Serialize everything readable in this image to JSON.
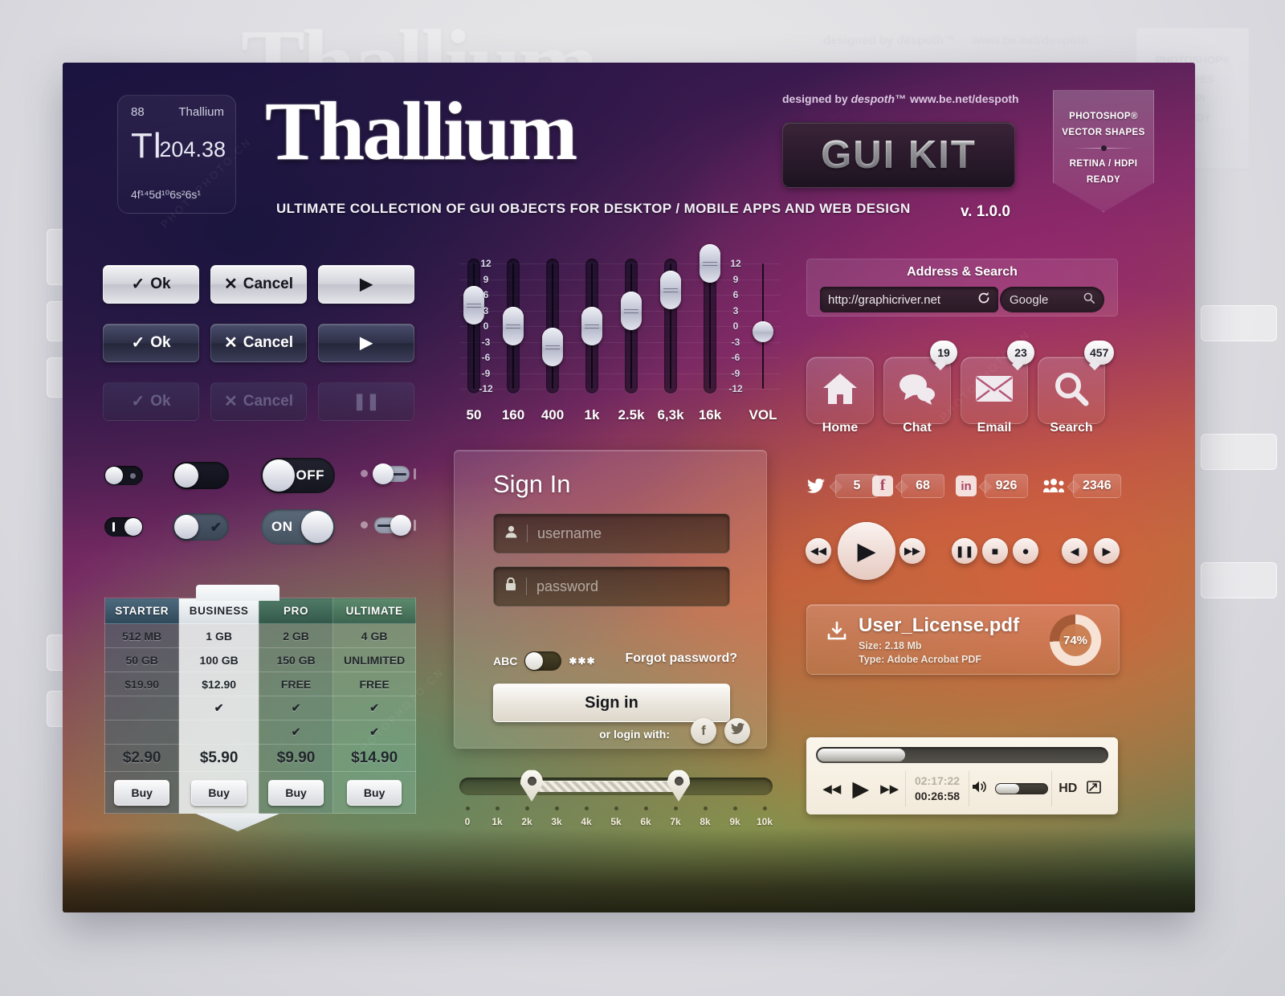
{
  "ghost": {
    "title": "Thallium",
    "credit": "designed by despoth™",
    "url": "www.be.net/despoth",
    "badge_line1": "PHOTOSHOP®",
    "badge_line2": "SHAPES",
    "badge_line3": "HDPI",
    "badge_line4": "READY"
  },
  "header": {
    "element": {
      "number": "88",
      "name": "Thallium",
      "symbol": "Tl",
      "mass": "204.38",
      "config": "4f¹⁴5d¹⁰6s²6s¹"
    },
    "brand": "Thallium",
    "tagline": "ULTIMATE COLLECTION OF GUI OBJECTS FOR DESKTOP / MOBILE APPS AND WEB DESIGN",
    "version": "v. 1.0.0",
    "credit": "designed by",
    "credit_brand": "despoth™",
    "url": "www.be.net/despoth",
    "gui_kit": "GUI KIT",
    "ps_badge": {
      "line1": "PHOTOSHOP®",
      "line2": "VECTOR SHAPES",
      "line3": "RETINA / HDPI",
      "line4": "READY"
    }
  },
  "buttons": {
    "rows": [
      {
        "style": "light",
        "ok": "Ok",
        "cancel": "Cancel",
        "play": "▶"
      },
      {
        "style": "dark",
        "ok": "Ok",
        "cancel": "Cancel",
        "play": "▶"
      },
      {
        "style": "disabled",
        "ok": "Ok",
        "cancel": "Cancel",
        "play": "❚❚"
      }
    ],
    "check_glyph": "✓",
    "x_glyph": "✕"
  },
  "equalizer": {
    "bands": [
      {
        "label": "50",
        "value": 4
      },
      {
        "label": "160",
        "value": 0
      },
      {
        "label": "400",
        "value": -4
      },
      {
        "label": "1k",
        "value": 0
      },
      {
        "label": "2.5k",
        "value": 3
      },
      {
        "label": "6,3k",
        "value": 7
      },
      {
        "label": "16k",
        "value": 12
      }
    ],
    "volume": {
      "label": "VOL",
      "value": -1
    },
    "scale": [
      "12",
      "9",
      "6",
      "3",
      "0",
      "-3",
      "-6",
      "-9",
      "-12"
    ],
    "scale_range": [
      -12,
      12
    ]
  },
  "toggles": {
    "off_label": "OFF",
    "on_label": "ON",
    "check_glyph": "✔"
  },
  "pricing": {
    "columns": [
      "STARTER",
      "BUSINESS",
      "PRO",
      "ULTIMATE"
    ],
    "rows": [
      [
        "512 MB",
        "1 GB",
        "2 GB",
        "4 GB"
      ],
      [
        "50 GB",
        "100 GB",
        "150 GB",
        "UNLIMITED"
      ],
      [
        "$19.90",
        "$12.90",
        "FREE",
        "FREE"
      ],
      [
        "",
        "✔",
        "✔",
        "✔"
      ],
      [
        "",
        "",
        "✔",
        "✔"
      ],
      [
        "$2.90",
        "$5.90",
        "$9.90",
        "$14.90"
      ]
    ],
    "buy_label": "Buy"
  },
  "signin": {
    "title": "Sign In",
    "username_placeholder": "username",
    "password_placeholder": "password",
    "user_icon": "👤",
    "lock_icon": "🔒",
    "abc_label": "ABC",
    "mask_label": "✱✱✱",
    "forgot_label": "Forgot password?",
    "submit_label": "Sign in",
    "or_login_with": "or login with:",
    "facebook_glyph": "f",
    "twitter_glyph": "t"
  },
  "address": {
    "title": "Address & Search",
    "url": "http://graphicriver.net",
    "reload_icon": "⟳",
    "search_engine": "Google",
    "search_icon": "🔍"
  },
  "tiles": [
    {
      "label": "Home",
      "icon": "home-icon",
      "badge": ""
    },
    {
      "label": "Chat",
      "icon": "chat-icon",
      "badge": "19"
    },
    {
      "label": "Email",
      "icon": "email-icon",
      "badge": "23"
    },
    {
      "label": "Search",
      "icon": "search-icon",
      "badge": "457"
    }
  ],
  "social": [
    {
      "network": "twitter",
      "glyph": "t",
      "count": "5"
    },
    {
      "network": "facebook",
      "glyph": "f",
      "count": "68"
    },
    {
      "network": "linkedin",
      "glyph": "in",
      "count": "926"
    },
    {
      "network": "myspace",
      "glyph": "m",
      "count": "2346"
    }
  ],
  "transport": {
    "prev": "◀◀",
    "play": "▶",
    "next": "▶▶",
    "pause": "❚❚",
    "stop": "■",
    "record": "●",
    "left": "◀",
    "right": "▶"
  },
  "download": {
    "filename": "User_License.pdf",
    "size": "Size: 2.18 Mb",
    "type": "Type: Adobe Acrobat PDF",
    "progress": "74%",
    "progress_value": 74,
    "icon": "download-icon"
  },
  "video": {
    "seek_percent": 30,
    "rewind": "◀◀",
    "play": "▶",
    "forward": "▶▶",
    "elapsed": "02:17:22",
    "remaining": "00:26:58",
    "volume_icon": "🔊",
    "volume_percent": 45,
    "hd_label": "HD",
    "fullscreen_icon": "⛶"
  },
  "range": {
    "left_percent": 23,
    "right_percent": 70,
    "tick_labels": [
      "0",
      "1k",
      "2k",
      "3k",
      "4k",
      "5k",
      "6k",
      "7k",
      "8k",
      "9k",
      "10k"
    ]
  },
  "watermarks": [
    "PHOTOPHOTO.CN",
    "PHOTOPHOTO.CN",
    "PHOTOPHOTO.CN"
  ]
}
